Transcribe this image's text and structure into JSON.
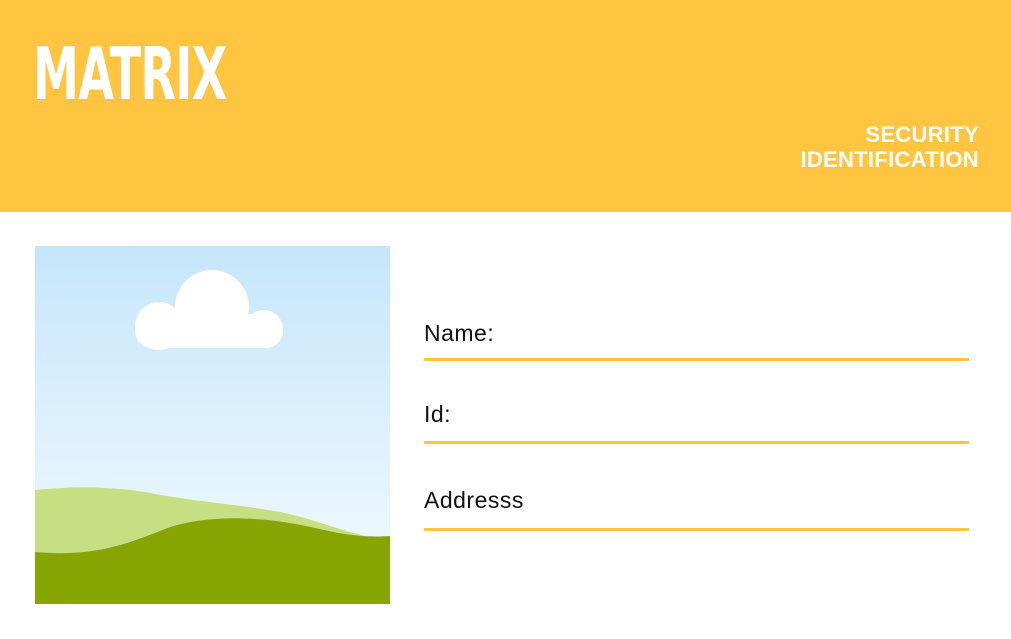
{
  "header": {
    "brand": "MATRIX",
    "subtitle_line1": "SECURITY",
    "subtitle_line2": "IDENTIFICATION"
  },
  "photo": {
    "icon": "landscape-photo-placeholder"
  },
  "fields": [
    {
      "label": "Name:"
    },
    {
      "label": "Id:"
    },
    {
      "label": "Addresss"
    }
  ],
  "colors": {
    "accent": "#ffc440",
    "sky_top": "#c6e6fb",
    "sky_bottom": "#f3fbff",
    "hill_light": "#c5df82",
    "hill_dark": "#86a501",
    "cloud": "#ffffff"
  }
}
